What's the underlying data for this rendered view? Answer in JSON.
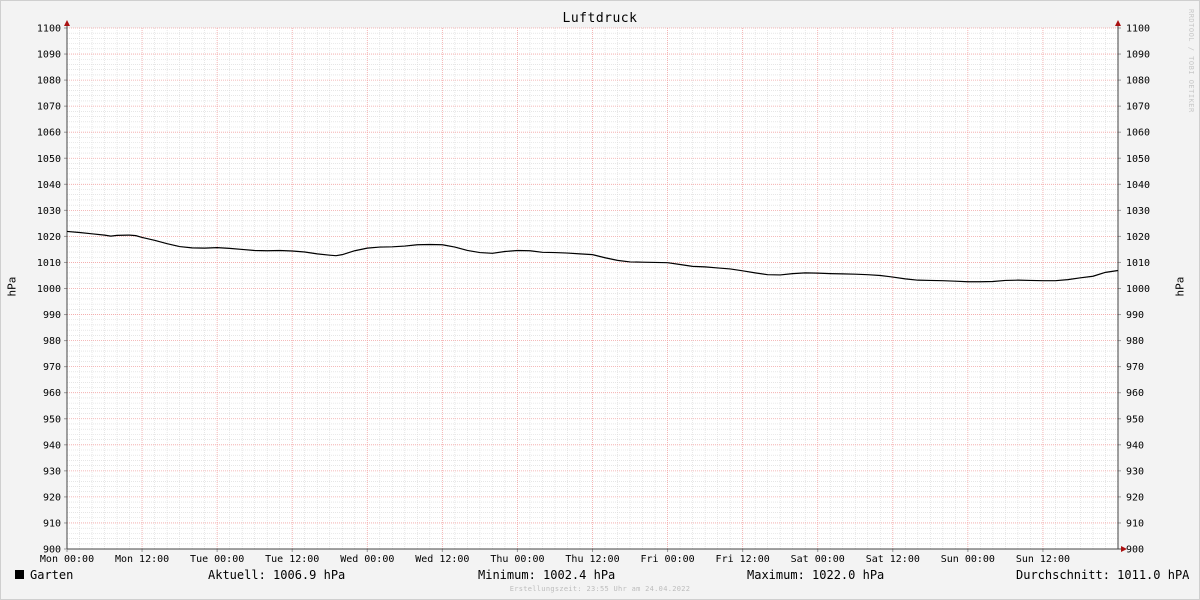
{
  "chart_data": {
    "type": "line",
    "title": "Luftdruck",
    "ylabel": "hPa",
    "ylim": [
      900,
      1100
    ],
    "y_ticks": [
      900,
      910,
      920,
      930,
      940,
      950,
      960,
      970,
      980,
      990,
      1000,
      1010,
      1020,
      1030,
      1040,
      1050,
      1060,
      1070,
      1080,
      1090,
      1100
    ],
    "x_ticks": [
      "Mon 00:00",
      "Mon 12:00",
      "Tue 00:00",
      "Tue 12:00",
      "Wed 00:00",
      "Wed 12:00",
      "Thu 00:00",
      "Thu 12:00",
      "Fri 00:00",
      "Fri 12:00",
      "Sat 00:00",
      "Sat 12:00",
      "Sun 00:00",
      "Sun 12:00"
    ],
    "x_unit": "hours since Mon 00:00",
    "x_range": [
      0,
      168
    ],
    "grid": true,
    "series": [
      {
        "name": "Garten",
        "color": "#000000",
        "points": [
          [
            0,
            1021.9
          ],
          [
            2,
            1021.5
          ],
          [
            4,
            1021.0
          ],
          [
            6,
            1020.5
          ],
          [
            7,
            1020.1
          ],
          [
            8,
            1020.4
          ],
          [
            10,
            1020.5
          ],
          [
            11,
            1020.3
          ],
          [
            12,
            1019.6
          ],
          [
            14,
            1018.5
          ],
          [
            16,
            1017.2
          ],
          [
            18,
            1016.1
          ],
          [
            20,
            1015.6
          ],
          [
            22,
            1015.5
          ],
          [
            24,
            1015.7
          ],
          [
            26,
            1015.4
          ],
          [
            28,
            1015.0
          ],
          [
            30,
            1014.6
          ],
          [
            32,
            1014.5
          ],
          [
            34,
            1014.6
          ],
          [
            36,
            1014.4
          ],
          [
            38,
            1014.0
          ],
          [
            40,
            1013.3
          ],
          [
            42,
            1012.8
          ],
          [
            43,
            1012.6
          ],
          [
            44,
            1013.0
          ],
          [
            46,
            1014.5
          ],
          [
            48,
            1015.5
          ],
          [
            50,
            1015.9
          ],
          [
            52,
            1016.0
          ],
          [
            54,
            1016.3
          ],
          [
            56,
            1016.8
          ],
          [
            58,
            1016.9
          ],
          [
            60,
            1016.8
          ],
          [
            62,
            1015.9
          ],
          [
            64,
            1014.6
          ],
          [
            66,
            1013.8
          ],
          [
            68,
            1013.5
          ],
          [
            70,
            1014.2
          ],
          [
            72,
            1014.6
          ],
          [
            74,
            1014.5
          ],
          [
            76,
            1013.9
          ],
          [
            78,
            1013.8
          ],
          [
            80,
            1013.6
          ],
          [
            82,
            1013.3
          ],
          [
            84,
            1013.0
          ],
          [
            86,
            1011.8
          ],
          [
            88,
            1010.8
          ],
          [
            90,
            1010.2
          ],
          [
            92,
            1010.1
          ],
          [
            94,
            1010.0
          ],
          [
            96,
            1009.9
          ],
          [
            98,
            1009.2
          ],
          [
            100,
            1008.5
          ],
          [
            102,
            1008.3
          ],
          [
            104,
            1007.9
          ],
          [
            106,
            1007.5
          ],
          [
            108,
            1006.8
          ],
          [
            110,
            1006.0
          ],
          [
            112,
            1005.3
          ],
          [
            114,
            1005.2
          ],
          [
            116,
            1005.7
          ],
          [
            118,
            1006.0
          ],
          [
            120,
            1005.9
          ],
          [
            122,
            1005.7
          ],
          [
            124,
            1005.6
          ],
          [
            126,
            1005.5
          ],
          [
            128,
            1005.3
          ],
          [
            130,
            1005.0
          ],
          [
            132,
            1004.4
          ],
          [
            134,
            1003.7
          ],
          [
            136,
            1003.2
          ],
          [
            138,
            1003.1
          ],
          [
            140,
            1003.0
          ],
          [
            142,
            1002.8
          ],
          [
            144,
            1002.6
          ],
          [
            146,
            1002.6
          ],
          [
            148,
            1002.7
          ],
          [
            150,
            1003.1
          ],
          [
            152,
            1003.2
          ],
          [
            154,
            1003.1
          ],
          [
            156,
            1003.0
          ],
          [
            158,
            1003.0
          ],
          [
            160,
            1003.4
          ],
          [
            162,
            1004.1
          ],
          [
            164,
            1004.7
          ],
          [
            166,
            1006.2
          ],
          [
            168,
            1006.9
          ]
        ]
      }
    ]
  },
  "legend": {
    "series_label": "Garten",
    "current": "Aktuell: 1006.9 hPa",
    "minimum": "Minimum: 1002.4 hPa",
    "maximum": "Maximum: 1022.0 hPa",
    "average": "Durchschnitt: 1011.0 hPA"
  },
  "watermark": "RRDTOOL / TOBI OETIKER",
  "footer": "Erstellungszeit: 23:55 Uhr am 24.04.2022"
}
